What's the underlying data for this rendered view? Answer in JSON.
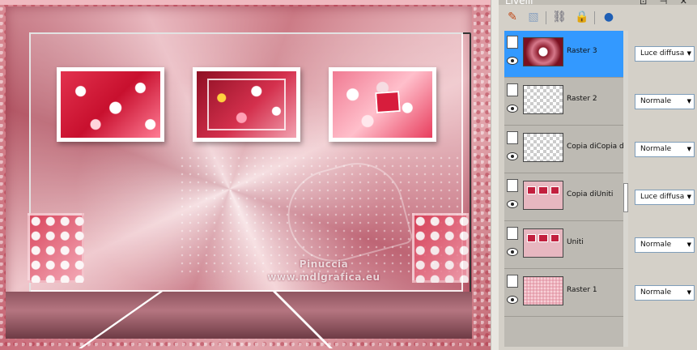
{
  "layers_panel": {
    "title": "Livelli",
    "window_controls": "⊡ ⊣ ✕",
    "toolbar": [
      {
        "icon": "paint-brush-icon"
      },
      {
        "icon": "mask-icon"
      },
      {
        "icon": "link-icon"
      },
      {
        "icon": "lock-icon"
      },
      {
        "icon": "sphere-icon"
      }
    ],
    "layers": [
      {
        "name": "Raster 3",
        "blend_mode": "Luce diffusa",
        "selected": true
      },
      {
        "name": "Raster 2",
        "blend_mode": "Normale",
        "selected": false
      },
      {
        "name": "Copia diCopia diU",
        "blend_mode": "Normale",
        "selected": false
      },
      {
        "name": "Copia diUniti",
        "blend_mode": "Luce diffusa",
        "selected": false
      },
      {
        "name": "Uniti",
        "blend_mode": "Normale",
        "selected": false
      },
      {
        "name": "Raster 1",
        "blend_mode": "Normale",
        "selected": false
      }
    ]
  },
  "canvas": {
    "watermark_line1": "Pinuccia",
    "watermark_line2": "www.mdlgrafica.eu"
  },
  "colors": {
    "selection": "#3399ff",
    "panel_bg": "#d4d0c8",
    "accent_pink": "#c86a78"
  }
}
